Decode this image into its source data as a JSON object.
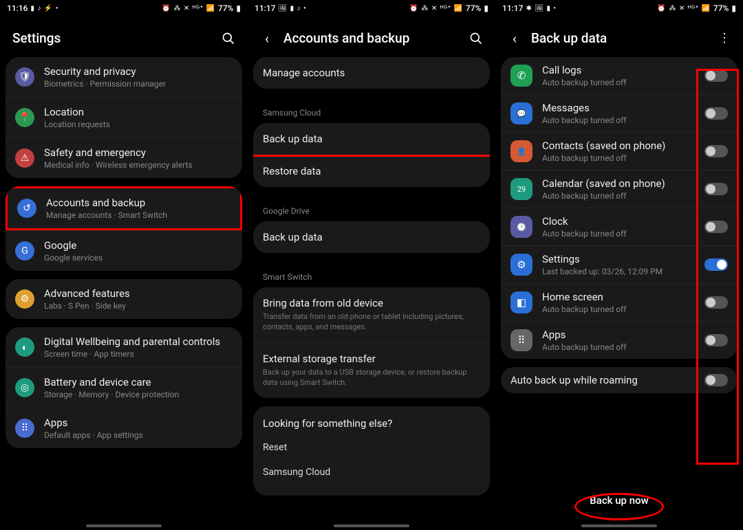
{
  "status": {
    "time1": "11:16",
    "time2": "11:17",
    "time3": "11:17",
    "left_icons1": "▮ ♪ ⚡ •",
    "left_icons2": "🖼 ▮ ♪ •",
    "left_icons3": "✱ 🖼 ▮ •",
    "right_icons": "⏰ ⁂ ✕ ᴴᴳ⁺ 📶",
    "battery": "77%"
  },
  "screen1": {
    "title": "Settings",
    "items": [
      {
        "title": "Security and privacy",
        "sub": "Biometrics · Permission manager",
        "icon": "🛡",
        "bg": "#5a5aa3"
      },
      {
        "title": "Location",
        "sub": "Location requests",
        "icon": "📍",
        "bg": "#2c9851"
      },
      {
        "title": "Safety and emergency",
        "sub": "Medical info · Wireless emergency alerts",
        "icon": "⚠",
        "bg": "#c24040"
      }
    ],
    "items2": [
      {
        "title": "Accounts and backup",
        "sub": "Manage accounts · Smart Switch",
        "icon": "↺",
        "bg": "#3670d6",
        "hl": true
      },
      {
        "title": "Google",
        "sub": "Google services",
        "icon": "G",
        "bg": "#3670d6"
      }
    ],
    "items3": [
      {
        "title": "Advanced features",
        "sub": "Labs · S Pen · Side key",
        "icon": "⚙",
        "bg": "#e0a030"
      }
    ],
    "items4": [
      {
        "title": "Digital Wellbeing and parental controls",
        "sub": "Screen time · App timers",
        "icon": "◐",
        "bg": "#1e9b7e"
      },
      {
        "title": "Battery and device care",
        "sub": "Storage · Memory · Device protection",
        "icon": "◎",
        "bg": "#1e9b7e"
      },
      {
        "title": "Apps",
        "sub": "Default apps · App settings",
        "icon": "⠿",
        "bg": "#4a6cd0"
      }
    ]
  },
  "screen2": {
    "title": "Accounts and backup",
    "manage": "Manage accounts",
    "sec1": "Samsung Cloud",
    "backup": "Back up data",
    "restore": "Restore data",
    "sec2": "Google Drive",
    "gbackup": "Back up data",
    "sec3": "Smart Switch",
    "bring_title": "Bring data from old device",
    "bring_sub": "Transfer data from an old phone or tablet including pictures, contacts, apps, and messages.",
    "ext_title": "External storage transfer",
    "ext_sub": "Back up your data to a USB storage device, or restore backup data using Smart Switch.",
    "looking": "Looking for something else?",
    "link1": "Reset",
    "link2": "Samsung Cloud"
  },
  "screen3": {
    "title": "Back up data",
    "items": [
      {
        "title": "Call logs",
        "sub": "Auto backup turned off",
        "icon": "✆",
        "bg": "#1fa055",
        "on": false
      },
      {
        "title": "Messages",
        "sub": "Auto backup turned off",
        "icon": "💬",
        "bg": "#2a6fd6",
        "on": false
      },
      {
        "title": "Contacts (saved on phone)",
        "sub": "Auto backup turned off",
        "icon": "👤",
        "bg": "#d55a33",
        "on": false
      },
      {
        "title": "Calendar (saved on phone)",
        "sub": "Auto backup turned off",
        "icon": "29",
        "bg": "#1e9b7e",
        "on": false
      },
      {
        "title": "Clock",
        "sub": "Auto backup turned off",
        "icon": "🕐",
        "bg": "#5a5aa3",
        "on": false
      },
      {
        "title": "Settings",
        "sub": "Last backed up: 03/26, 12:09 PM",
        "icon": "⚙",
        "bg": "#2a6fd6",
        "on": true
      },
      {
        "title": "Home screen",
        "sub": "Auto backup turned off",
        "icon": "◧",
        "bg": "#2a6fd6",
        "on": false
      },
      {
        "title": "Apps",
        "sub": "Auto backup turned off",
        "icon": "⠿",
        "bg": "#666",
        "on": false
      }
    ],
    "roaming": "Auto back up while roaming",
    "button": "Back up now"
  }
}
